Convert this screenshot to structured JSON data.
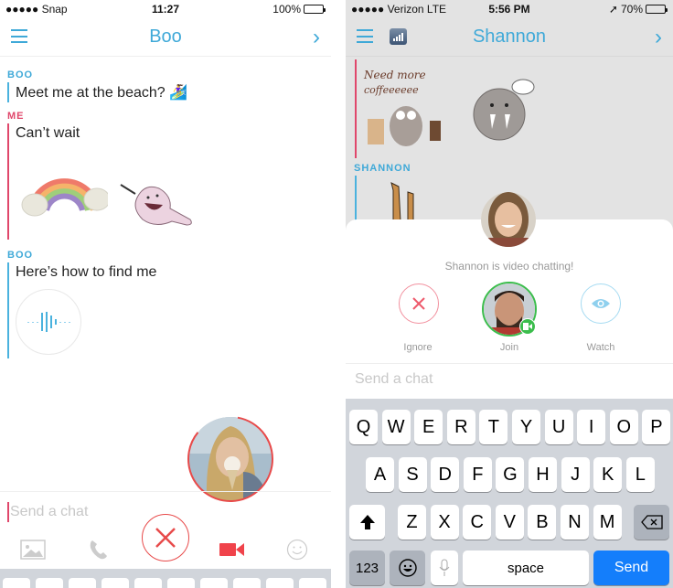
{
  "left": {
    "status": {
      "carrier": "●●●●● Snap",
      "time": "11:27",
      "battery": "100%",
      "battery_level": 1.0
    },
    "header": {
      "title": "Boo"
    },
    "messages": [
      {
        "sender": "BOO",
        "text": "Meet me at the beach? 🏄‍♀️"
      },
      {
        "sender": "ME",
        "text": "Can’t wait"
      },
      {
        "sender": "BOO",
        "text": "Here’s how to find me"
      }
    ],
    "stickers": [
      "rainbow-sticker",
      "ghost-sticker"
    ],
    "audio_icon": "audio-note-icon",
    "input": {
      "placeholder": "Send a chat"
    },
    "toolbar": [
      "image-icon",
      "phone-icon",
      "end-call-icon",
      "video-icon",
      "smiley-icon"
    ],
    "colors": {
      "accent": "#3fa9d8",
      "me": "#e0476b",
      "end_call": "#e84a4a"
    }
  },
  "right": {
    "status": {
      "carrier": "●●●●● Verizon  LTE",
      "time": "5:56 PM",
      "battery": "70%",
      "battery_level": 0.7
    },
    "header": {
      "title": "Shannon"
    },
    "messages": [
      {
        "sender": "",
        "sticker_text": "Need more coffeeeeeeee"
      },
      {
        "sender": "SHANNON"
      }
    ],
    "video_sheet": {
      "text": "Shannon is video chatting!",
      "actions": [
        {
          "label": "Ignore",
          "icon": "close-icon"
        },
        {
          "label": "Join",
          "icon": "video-icon"
        },
        {
          "label": "Watch",
          "icon": "eye-icon"
        }
      ]
    },
    "input": {
      "placeholder": "Send a chat"
    },
    "keyboard": {
      "row1": [
        "Q",
        "W",
        "E",
        "R",
        "T",
        "Y",
        "U",
        "I",
        "O",
        "P"
      ],
      "row2": [
        "A",
        "S",
        "D",
        "F",
        "G",
        "H",
        "J",
        "K",
        "L"
      ],
      "row3": [
        "Z",
        "X",
        "C",
        "V",
        "B",
        "N",
        "M"
      ],
      "numbers": "123",
      "space": "space",
      "send": "Send"
    },
    "colors": {
      "accent": "#3fa9d8",
      "join": "#3bbd4c",
      "send": "#147efb"
    }
  }
}
